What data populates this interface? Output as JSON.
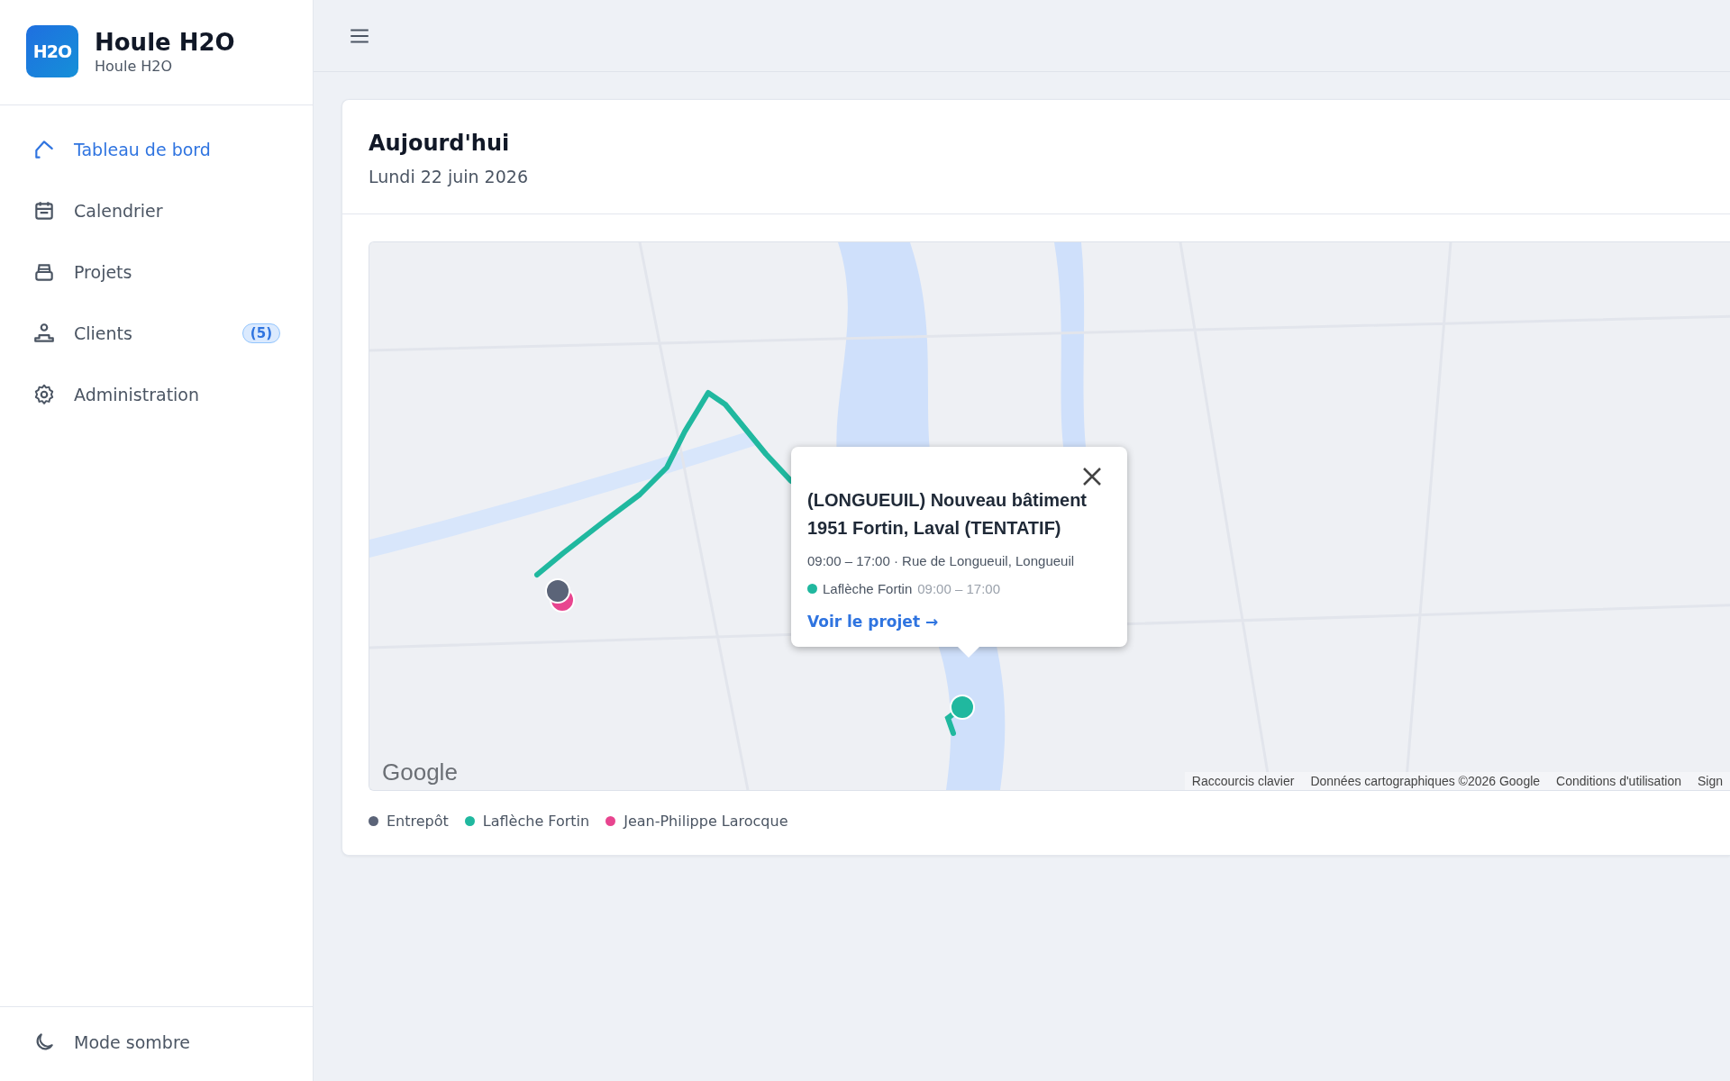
{
  "brand": {
    "logo": "H2O",
    "name": "Houle H2O",
    "subtitle": "Houle H2O"
  },
  "nav": [
    {
      "label": "Tableau de bord",
      "selected": true
    },
    {
      "label": "Calendrier",
      "selected": false
    },
    {
      "label": "Projets",
      "selected": false
    },
    {
      "label": "Clients",
      "selected": false,
      "badge": "(5)"
    },
    {
      "label": "Administration",
      "selected": false
    }
  ],
  "footer": {
    "label": "Mode sombre"
  },
  "today": {
    "title": "Aujourd'hui",
    "date": "Lundi 22 juin 2026"
  },
  "map": {
    "logo": "Google",
    "attribution": [
      "Raccourcis clavier",
      "Données cartographiques ©2026 Google",
      "Conditions d'utilisation",
      "Sign"
    ],
    "popup": {
      "title": "(LONGUEUIL) Nouveau bâtiment 1951 Fortin, Laval (TENTATIF)",
      "details": "09:00 – 17:00 · Rue de Longueuil, Longueuil",
      "assignments": [
        {
          "name": "Laflèche Fortin",
          "time": "09:00 – 17:00",
          "color": "#20b89f"
        }
      ],
      "link": "Voir le projet →"
    }
  },
  "legend": [
    {
      "label": "Entrepôt",
      "color": "#5b6478"
    },
    {
      "label": "Laflèche Fortin",
      "color": "#20b89f"
    },
    {
      "label": "Jean-Philippe Larocque",
      "color": "#e8458f"
    }
  ]
}
